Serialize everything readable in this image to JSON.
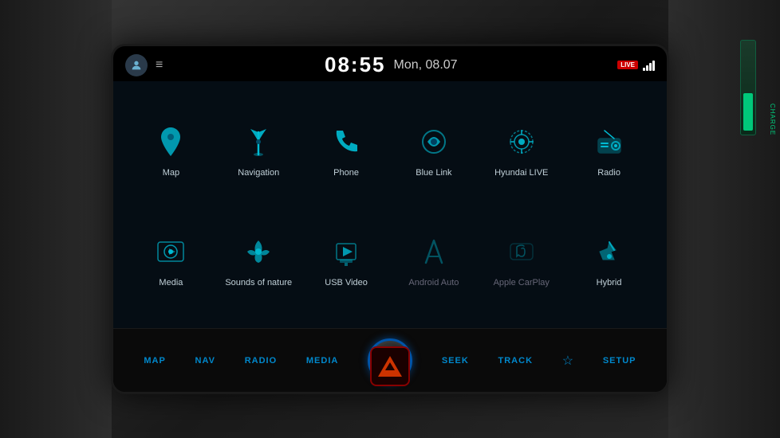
{
  "statusBar": {
    "time": "08:55",
    "date": "Mon, 08.07",
    "liveBadge": "LIVE",
    "menuIcon": "≡"
  },
  "apps": [
    {
      "id": "map",
      "label": "Map",
      "icon": "map",
      "dimmed": false
    },
    {
      "id": "navigation",
      "label": "Navigation",
      "icon": "navigation",
      "dimmed": false
    },
    {
      "id": "phone",
      "label": "Phone",
      "icon": "phone",
      "dimmed": false
    },
    {
      "id": "bluelink",
      "label": "Blue Link",
      "icon": "bluelink",
      "dimmed": false
    },
    {
      "id": "hyundailive",
      "label": "Hyundai LIVE",
      "icon": "hyundailive",
      "dimmed": false
    },
    {
      "id": "radio",
      "label": "Radio",
      "icon": "radio",
      "dimmed": false
    },
    {
      "id": "media",
      "label": "Media",
      "icon": "media",
      "dimmed": false
    },
    {
      "id": "soundsofnature",
      "label": "Sounds of nature",
      "icon": "soundsofnature",
      "dimmed": false
    },
    {
      "id": "usbvideo",
      "label": "USB Video",
      "icon": "usbvideo",
      "dimmed": false
    },
    {
      "id": "androidauto",
      "label": "Android Auto",
      "icon": "androidauto",
      "dimmed": true
    },
    {
      "id": "applecarplay",
      "label": "Apple CarPlay",
      "icon": "applecarplay",
      "dimmed": true
    },
    {
      "id": "hybrid",
      "label": "Hybrid",
      "icon": "hybrid",
      "dimmed": false
    }
  ],
  "controls": {
    "map": "MAP",
    "nav": "NAV",
    "radio": "RADIO",
    "media": "MEDIA",
    "seek": "SEEK",
    "track": "TRACK",
    "setup": "SETUP"
  }
}
